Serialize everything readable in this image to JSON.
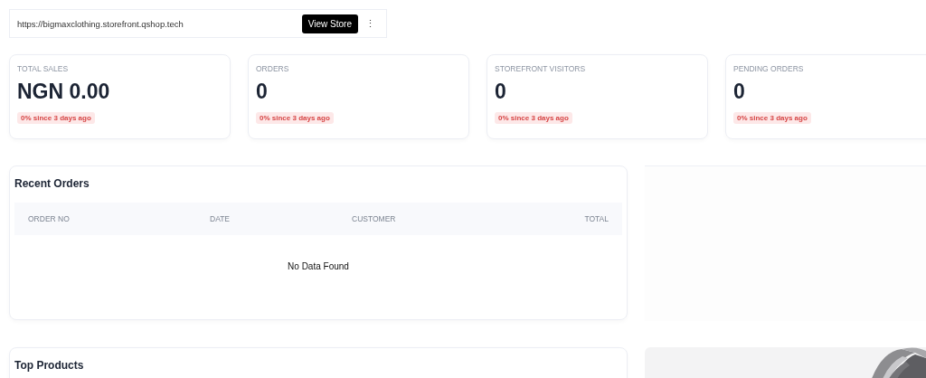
{
  "store_bar": {
    "url": "https://bigmaxclothing.storefront.qshop.tech",
    "button": "View Store",
    "menu": "⋮"
  },
  "stats": [
    {
      "label": "TOTAL SALES",
      "value": "NGN 0.00",
      "change": "0% since 3 days ago"
    },
    {
      "label": "ORDERS",
      "value": "0",
      "change": "0% since 3 days ago"
    },
    {
      "label": "STOREFRONT VISITORS",
      "value": "0",
      "change": "0% since 3 days ago"
    },
    {
      "label": "PENDING ORDERS",
      "value": "0",
      "change": "0% since 3 days ago"
    }
  ],
  "recent_orders": {
    "title": "Recent Orders",
    "columns": [
      "ORDER NO",
      "DATE",
      "CUSTOMER",
      "TOTAL"
    ],
    "empty": "No Data Found"
  },
  "top_products": {
    "title": "Top Products"
  }
}
